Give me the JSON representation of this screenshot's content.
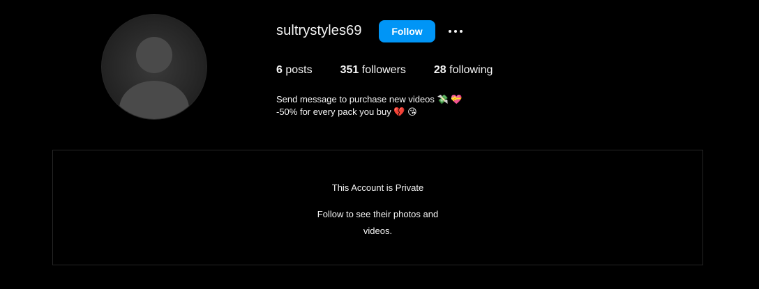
{
  "profile": {
    "username": "sultrystyles69",
    "follow_label": "Follow",
    "more_label": "More options",
    "stats": {
      "posts_count": "6",
      "posts_label": "posts",
      "followers_count": "351",
      "followers_label": "followers",
      "following_count": "28",
      "following_label": "following"
    },
    "bio": {
      "line1": "Send message to purchase new videos 💸 💝",
      "line2": "-50% for every pack you buy 💔 😘"
    }
  },
  "private_notice": {
    "title": "This Account is Private",
    "subtitle": "Follow to see their photos and videos."
  },
  "colors": {
    "background": "#000000",
    "text": "#f5f5f5",
    "accent": "#0095f6",
    "border": "#262626"
  },
  "icons": {
    "avatar": "profile-photo",
    "more": "more-dots-icon"
  }
}
